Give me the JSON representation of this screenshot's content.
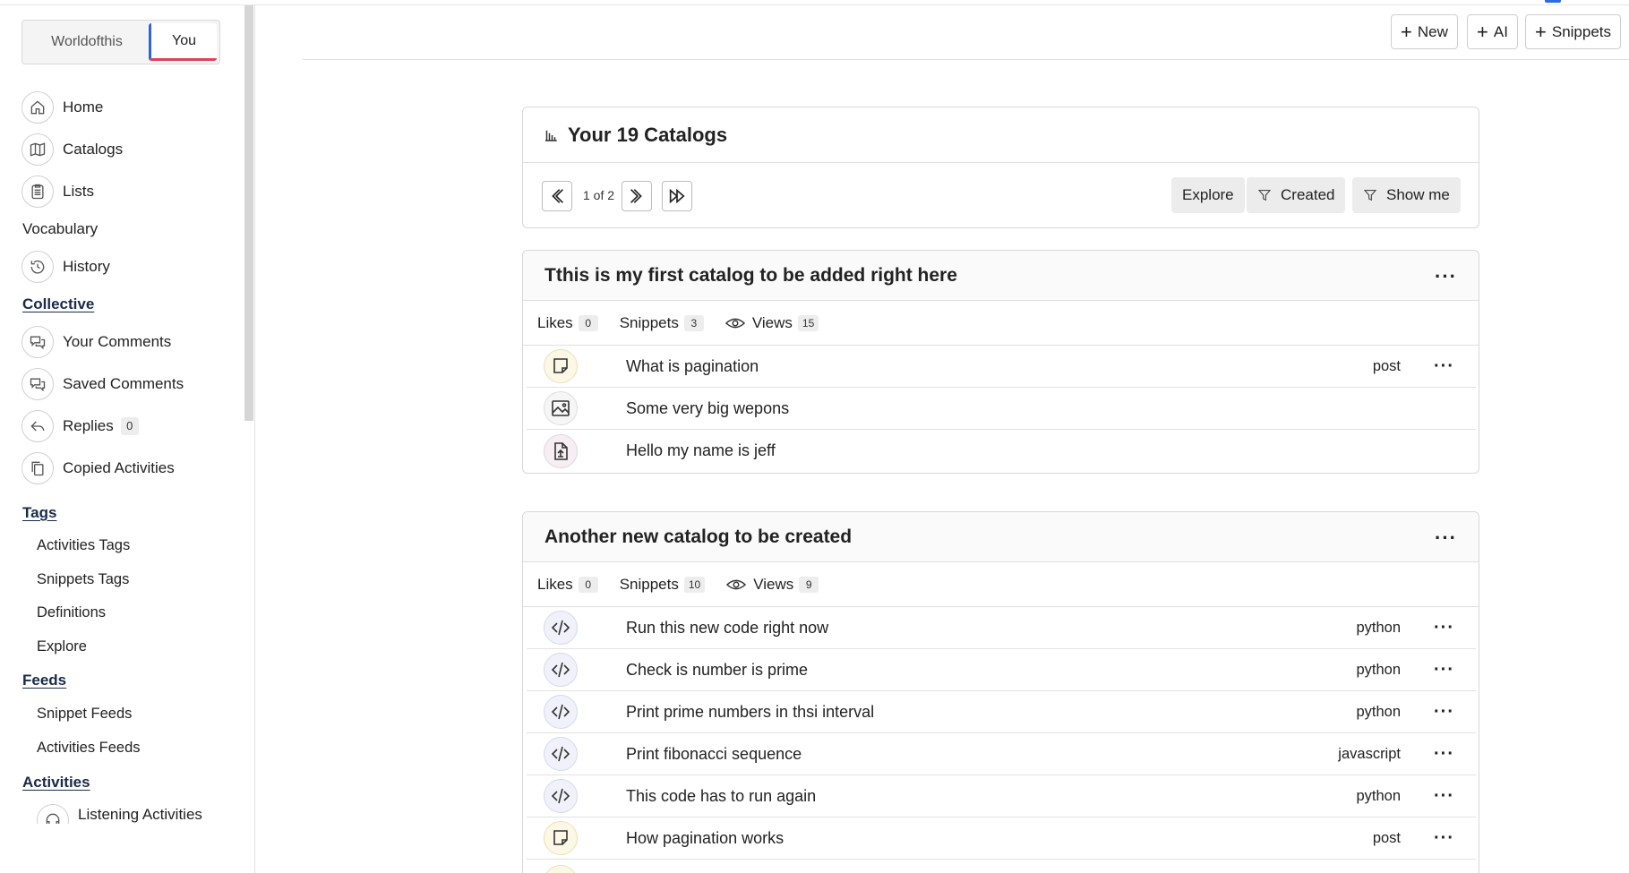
{
  "switcher": {
    "options": [
      "Worldofthis",
      "You"
    ],
    "active": "You"
  },
  "sidebar": {
    "home": "Home",
    "catalogs": "Catalogs",
    "lists": "Lists",
    "vocabulary": "Vocabulary",
    "history": "History",
    "collective": "Collective",
    "your_comments": "Your Comments",
    "saved_comments": "Saved Comments",
    "replies": "Replies",
    "replies_count": "0",
    "copied_activities": "Copied Activities",
    "tags": "Tags",
    "activities_tags": "Activities Tags",
    "snippets_tags": "Snippets Tags",
    "definitions": "Definitions",
    "explore": "Explore",
    "feeds": "Feeds",
    "snippet_feeds": "Snippet Feeds",
    "activities_feeds": "Activities Feeds",
    "activities": "Activities",
    "listening_activities": "Listening Activities"
  },
  "toolbar": {
    "new_label": "New",
    "ai_label": "AI",
    "snippets_label": "Snippets"
  },
  "catalogs_panel": {
    "title": "Your 19 Catalogs",
    "pager": "1 of 2",
    "explore_label": "Explore",
    "created_label": "Created",
    "showme_label": "Show me"
  },
  "catalogs": [
    {
      "title": "Tthis is my first catalog to be added right here",
      "likes_label": "Likes",
      "likes": "0",
      "snippets_label": "Snippets",
      "snippets": "3",
      "views_label": "Views",
      "views": "15",
      "items": [
        {
          "icon": "note-icon",
          "text": "What is pagination",
          "tag": "post"
        },
        {
          "icon": "image-icon",
          "text": "Some very big wepons",
          "tag": ""
        },
        {
          "icon": "file-upload-icon",
          "text": "Hello my name is jeff",
          "tag": ""
        }
      ]
    },
    {
      "title": "Another new catalog to be created",
      "likes_label": "Likes",
      "likes": "0",
      "snippets_label": "Snippets",
      "snippets": "10",
      "views_label": "Views",
      "views": "9",
      "items": [
        {
          "icon": "code-icon",
          "text": "Run this new code right now",
          "tag": "python"
        },
        {
          "icon": "code-icon",
          "text": "Check is number is prime",
          "tag": "python"
        },
        {
          "icon": "code-icon",
          "text": "Print prime numbers in thsi interval",
          "tag": "python"
        },
        {
          "icon": "code-icon",
          "text": "Print fibonacci sequence",
          "tag": "javascript"
        },
        {
          "icon": "code-icon",
          "text": "This code has to run again",
          "tag": "python"
        },
        {
          "icon": "note-icon",
          "text": "How pagination works",
          "tag": "post"
        }
      ]
    }
  ],
  "colors": {
    "accent_blue": "#2f63d8",
    "accent_red": "#d9465a"
  }
}
